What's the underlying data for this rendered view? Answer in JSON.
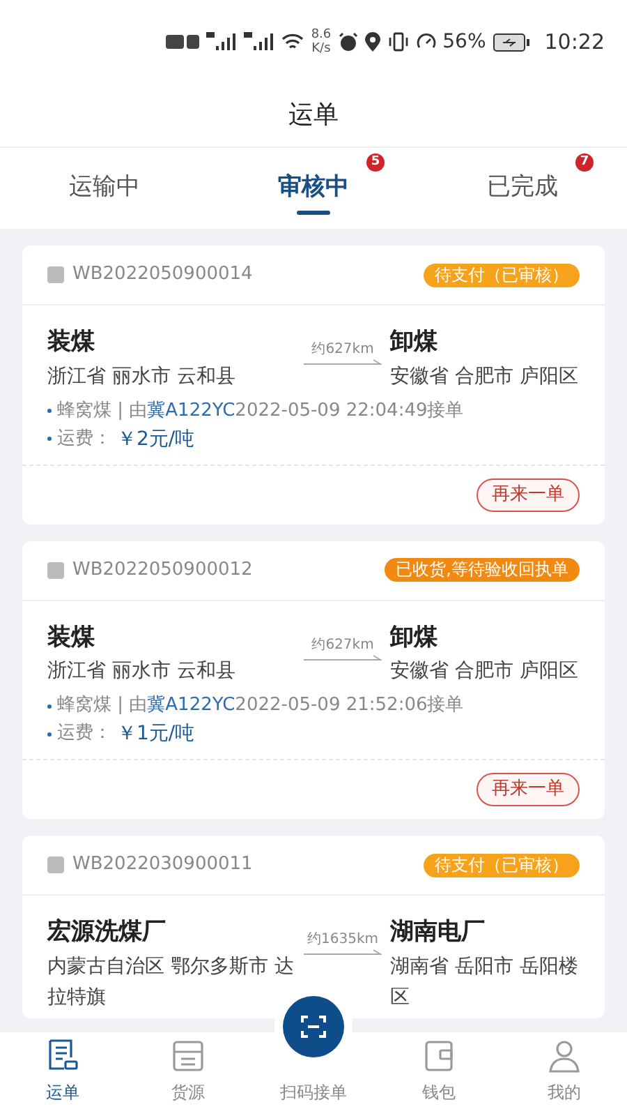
{
  "status_bar": {
    "speed": "8.6",
    "speed_unit": "K/s",
    "battery": "56%",
    "time": "10:22"
  },
  "title": "运单",
  "tabs": [
    {
      "label": "运输中",
      "selected": false
    },
    {
      "label": "审核中",
      "selected": true,
      "badge": "5"
    },
    {
      "label": "已完成",
      "selected": false,
      "badge": "7"
    }
  ],
  "orders": [
    {
      "number": "WB2022050900014",
      "status": "待支付（已审核）",
      "color": "#f7a21b",
      "from_name": "装煤",
      "from_address": "浙江省 丽水市 云和县",
      "distance": "约627km",
      "to_name": "卸煤",
      "to_address": "安徽省 合肥市 庐阳区",
      "cargo": "蜂窝煤 | 由",
      "plate": "冀A122YC",
      "accepted": "2022-05-09 22:04:49接单",
      "fee_label": "运费：",
      "fee": "￥2元/吨",
      "action": "再来一单"
    },
    {
      "number": "WB2022050900012",
      "status": "已收货,等待验收回执单",
      "color": "#f28a12",
      "from_name": "装煤",
      "from_address": "浙江省 丽水市 云和县",
      "distance": "约627km",
      "to_name": "卸煤",
      "to_address": "安徽省 合肥市 庐阳区",
      "cargo": "蜂窝煤 | 由",
      "plate": "冀A122YC",
      "accepted": "2022-05-09 21:52:06接单",
      "fee_label": "运费：",
      "fee": "￥1元/吨",
      "action": "再来一单"
    },
    {
      "number": "WB2022030900011",
      "status": "待支付（已审核）",
      "color": "#f7a21b",
      "from_name": "宏源洗煤厂",
      "from_address": "内蒙古自治区 鄂尔多斯市 达拉特旗",
      "distance": "约1635km",
      "to_name": "湖南电厂",
      "to_address": "湖南省 岳阳市 岳阳楼区"
    }
  ],
  "nav": [
    {
      "label": "运单",
      "selected": true,
      "kind": "orders"
    },
    {
      "label": "货源",
      "selected": false,
      "kind": "goods"
    },
    {
      "label": "扫码接单",
      "selected": false,
      "kind": "scan"
    },
    {
      "label": "钱包",
      "selected": false,
      "kind": "wallet"
    },
    {
      "label": "我的",
      "selected": false,
      "kind": "profile"
    }
  ]
}
